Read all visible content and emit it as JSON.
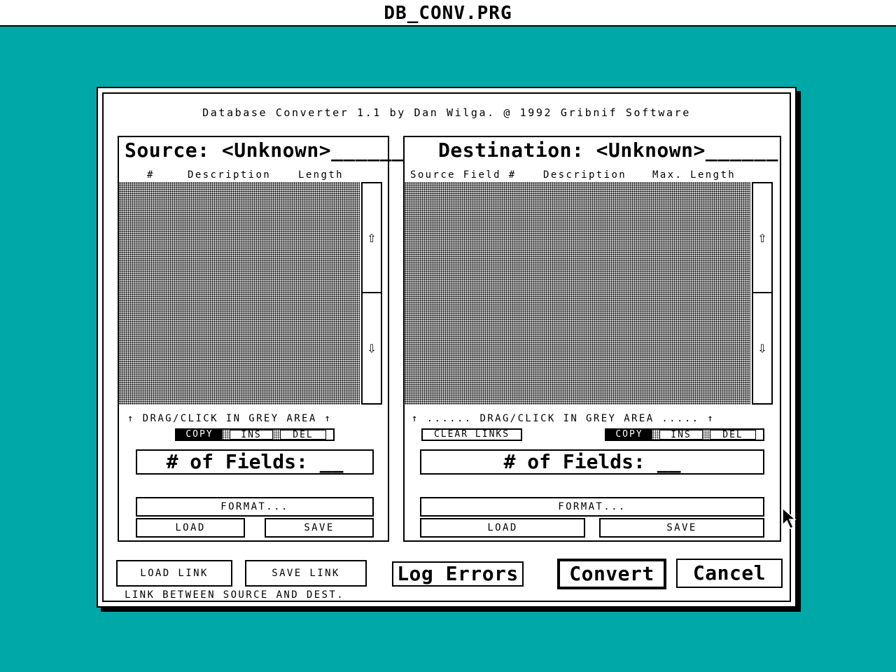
{
  "window": {
    "title": "DB_CONV.PRG"
  },
  "dialog": {
    "credit": "Database Converter 1.1 by Dan Wilga. @ 1992 Gribnif Software"
  },
  "source": {
    "title": "Source: <Unknown>______",
    "columns": [
      "#",
      "Description",
      "Length"
    ],
    "drag_hint": "↑ DRAG/CLICK IN GREY AREA ↑",
    "buttons": {
      "copy": "COPY",
      "ins": "INS",
      "del": "DEL"
    },
    "field_count": "# of Fields: __",
    "format_label": "FORMAT...",
    "load_label": "LOAD",
    "save_label": "SAVE",
    "scroll_up_icon": "⇧",
    "scroll_down_icon": "⇩"
  },
  "destination": {
    "title": "Destination: <Unknown>______",
    "columns": [
      "Source Field #",
      "Description",
      "Max. Length"
    ],
    "drag_hint": "↑ ...... DRAG/CLICK IN GREY AREA ..... ↑",
    "clear_links_label": "CLEAR LINKS",
    "buttons": {
      "copy": "COPY",
      "ins": "INS",
      "del": "DEL"
    },
    "field_count": "# of Fields: __",
    "format_label": "FORMAT...",
    "load_label": "LOAD",
    "save_label": "SAVE",
    "scroll_up_icon": "⇧",
    "scroll_down_icon": "⇩"
  },
  "footer": {
    "load_link_label": "LOAD LINK",
    "save_link_label": "SAVE LINK",
    "link_caption": "LINK BETWEEN SOURCE AND DEST.",
    "log_errors_label": "Log Errors",
    "convert_label": "Convert",
    "cancel_label": "Cancel"
  },
  "colors": {
    "desktop": "#00a8a8",
    "window": "#ffffff",
    "ink": "#000000"
  }
}
